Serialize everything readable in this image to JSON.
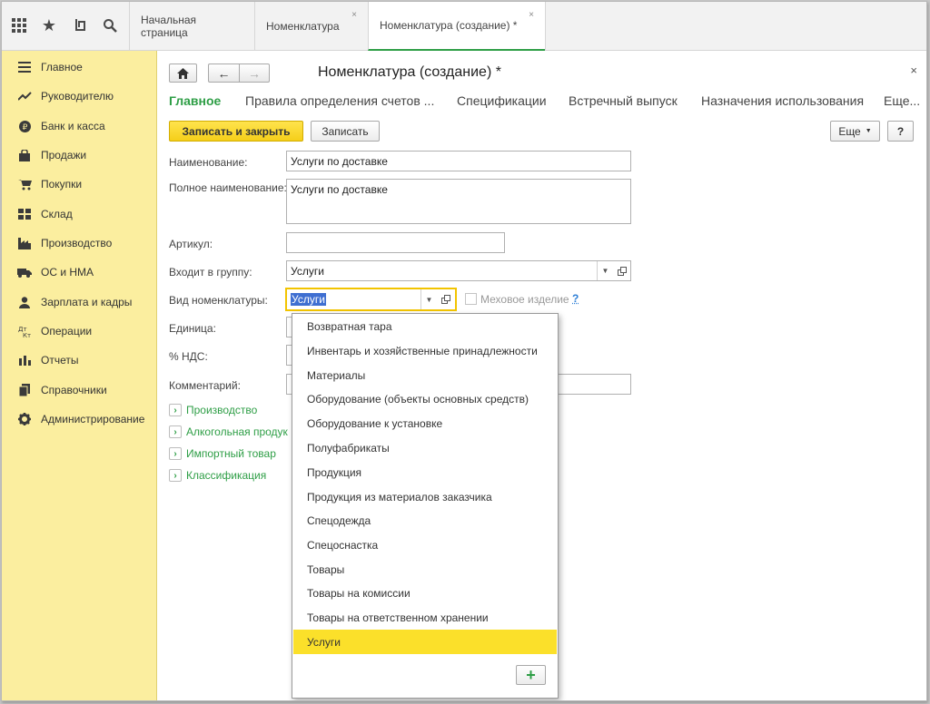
{
  "topbar": {
    "tabs": [
      {
        "label": "Начальная страница"
      },
      {
        "label": "Номенклатура",
        "close": "×"
      },
      {
        "label": "Номенклатура (создание) *",
        "close": "×"
      }
    ]
  },
  "sidebar": {
    "items": [
      {
        "label": "Главное",
        "icon": "menu-lines-icon"
      },
      {
        "label": "Руководителю",
        "icon": "trend-icon"
      },
      {
        "label": "Банк и касса",
        "icon": "ruble-icon"
      },
      {
        "label": "Продажи",
        "icon": "bag-icon"
      },
      {
        "label": "Покупки",
        "icon": "cart-icon"
      },
      {
        "label": "Склад",
        "icon": "warehouse-icon"
      },
      {
        "label": "Производство",
        "icon": "factory-icon"
      },
      {
        "label": "ОС и НМА",
        "icon": "truck-icon"
      },
      {
        "label": "Зарплата и кадры",
        "icon": "person-icon"
      },
      {
        "label": "Операции",
        "icon": "operations-icon"
      },
      {
        "label": "Отчеты",
        "icon": "bar-chart-icon"
      },
      {
        "label": "Справочники",
        "icon": "books-icon"
      },
      {
        "label": "Администрирование",
        "icon": "gear-icon"
      }
    ]
  },
  "window": {
    "title": "Номенклатура (создание) *",
    "close": "×"
  },
  "form_tabs": [
    {
      "label": "Главное"
    },
    {
      "label": "Правила определения счетов ..."
    },
    {
      "label": "Спецификации"
    },
    {
      "label": "Встречный выпуск"
    },
    {
      "label": "Назначения использования"
    },
    {
      "label": "Еще..."
    }
  ],
  "toolbar": {
    "save_close": "Записать и закрыть",
    "save": "Записать",
    "more": "Еще",
    "help": "?"
  },
  "form": {
    "name_label": "Наименование:",
    "name_value": "Услуги по доставке",
    "full_name_label": "Полное наименование:",
    "full_name_value": "Услуги по доставке",
    "article_label": "Артикул:",
    "article_value": "",
    "group_label": "Входит в группу:",
    "group_value": "Услуги",
    "kind_label": "Вид номенклатуры:",
    "kind_value": "Услуги",
    "fur_label": "Меховое изделие",
    "fur_help": "?",
    "unit_label": "Единица:",
    "vat_label": "% НДС:",
    "comment_label": "Комментарий:"
  },
  "groups": [
    {
      "label": "Производство"
    },
    {
      "label": "Алкогольная продук"
    },
    {
      "label": "Импортный товар"
    },
    {
      "label": "Классификация"
    }
  ],
  "dropdown": {
    "items": [
      {
        "label": "Возвратная тара"
      },
      {
        "label": "Инвентарь и хозяйственные принадлежности"
      },
      {
        "label": "Материалы"
      },
      {
        "label": "Оборудование (объекты основных средств)"
      },
      {
        "label": "Оборудование к установке"
      },
      {
        "label": "Полуфабрикаты"
      },
      {
        "label": "Продукция"
      },
      {
        "label": "Продукция из материалов заказчика"
      },
      {
        "label": "Спецодежда"
      },
      {
        "label": "Спецоснастка"
      },
      {
        "label": "Товары"
      },
      {
        "label": "Товары на комиссии"
      },
      {
        "label": "Товары на ответственном хранении"
      },
      {
        "label": "Услуги"
      }
    ],
    "selected_index": 13,
    "add_label": "+"
  },
  "colors": {
    "accent_green": "#2e9e46",
    "sidebar_yellow": "#fbee9f",
    "primary_button": "#f5cf19",
    "selection_yellow": "#fbe02a"
  }
}
